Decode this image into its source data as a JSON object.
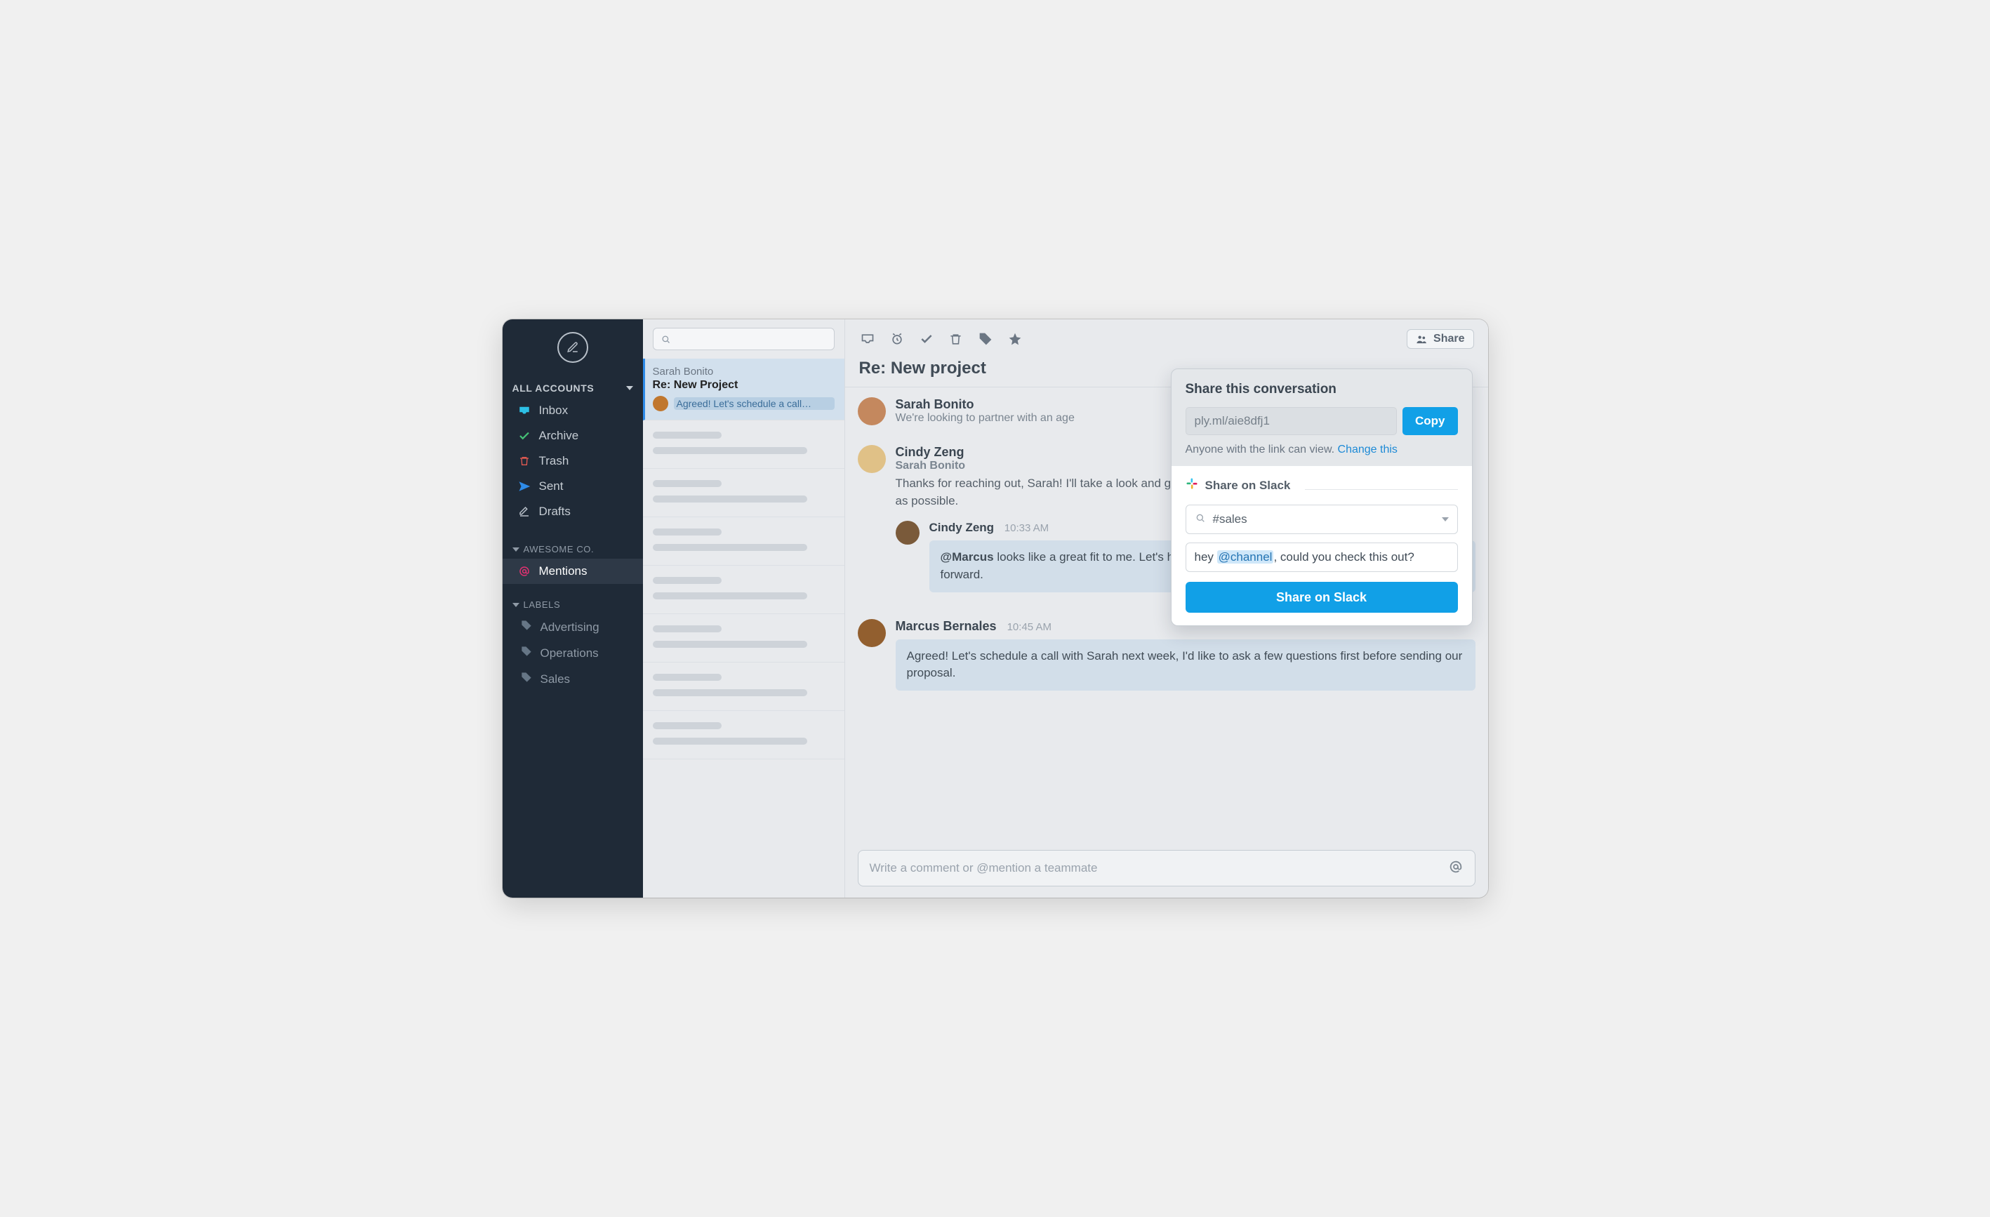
{
  "sidebar": {
    "accounts_header": "ALL ACCOUNTS",
    "items": [
      {
        "label": "Inbox"
      },
      {
        "label": "Archive"
      },
      {
        "label": "Trash"
      },
      {
        "label": "Sent"
      },
      {
        "label": "Drafts"
      }
    ],
    "workspace_header": "AWESOME CO.",
    "mentions_label": "Mentions",
    "labels_header": "LABELS",
    "labels": [
      {
        "label": "Advertising"
      },
      {
        "label": "Operations"
      },
      {
        "label": "Sales"
      }
    ]
  },
  "threadlist": {
    "selected": {
      "from": "Sarah Bonito",
      "subject": "Re:  New Project",
      "excerpt": "Agreed! Let's schedule a call…"
    }
  },
  "toolbar": {
    "share_label": "Share"
  },
  "conversation": {
    "title": "Re: New project",
    "msg1": {
      "name": "Sarah Bonito",
      "sub": "We're looking to partner with an age"
    },
    "msg2": {
      "names": "Cindy Zeng",
      "sub": "Sarah Bonito",
      "text": "Thanks for reaching out, Sarah! I'll take a look and get back to you with an ideal timeline and pricing as soon as possible."
    },
    "reply1": {
      "name": "Cindy Zeng",
      "time": "10:33 AM",
      "mention": "@Marcus",
      "text": " looks like a great fit to me. Let's have them approve a project outline before moving forward."
    },
    "reply2": {
      "name": "Marcus Bernales",
      "time": "10:45 AM",
      "text": "Agreed! Let's schedule a call with Sarah next week, I'd like to ask a few questions first before sending our proposal."
    },
    "compose_placeholder": "Write a comment or @mention a teammate"
  },
  "share": {
    "title": "Share this conversation",
    "url": "ply.ml/aie8dfj1",
    "copy_label": "Copy",
    "perm_text": "Anyone with the link can view. ",
    "perm_link": "Change this",
    "slack_head": "Share on Slack",
    "channel_value": "#sales",
    "msg_pre": "hey ",
    "msg_mention": "@channel",
    "msg_post": ", could you check this out?",
    "share_btn": "Share on Slack"
  }
}
